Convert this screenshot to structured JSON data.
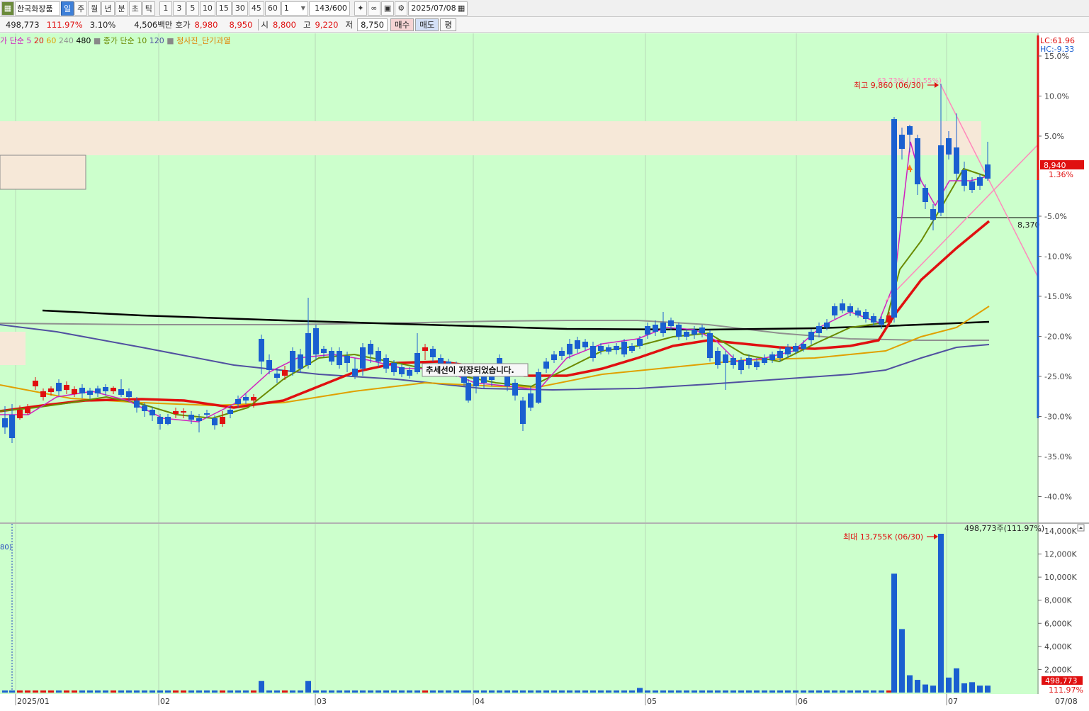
{
  "toolbar": {
    "stock_name": "한국화장품",
    "period_tabs": [
      {
        "label": "일",
        "active": true
      },
      {
        "label": "주",
        "active": false
      },
      {
        "label": "월",
        "active": false
      },
      {
        "label": "년",
        "active": false
      },
      {
        "label": "분",
        "active": false
      },
      {
        "label": "초",
        "active": false
      },
      {
        "label": "틱",
        "active": false
      }
    ],
    "interval_buttons": [
      "1",
      "3",
      "5",
      "10",
      "15",
      "30",
      "45",
      "60"
    ],
    "interval_select": "1",
    "count": "143",
    "count_total": "/600",
    "date": "2025/07/08"
  },
  "quote": {
    "volume": "498,773",
    "volume_ratio": "111.97%",
    "change_rate": "3.10%",
    "amount": "4,506백만",
    "bid_label": "호가",
    "bid1": "8,980",
    "bid2": "8,950",
    "open_label": "시",
    "open": "8,800",
    "high_label": "고",
    "high": "9,220",
    "low_label": "저",
    "low": "8,750",
    "buy_label": "매수",
    "sell_label": "매도",
    "flat_label": "평"
  },
  "legend": {
    "ma_prefix": "가 단순",
    "ma_values": [
      {
        "label": "5",
        "color": "#d020c0"
      },
      {
        "label": "20",
        "color": "#e01010"
      },
      {
        "label": "60",
        "color": "#e0a000"
      },
      {
        "label": "240",
        "color": "#909090"
      },
      {
        "label": "480",
        "color": "#000000"
      }
    ],
    "ma2_prefix": "종가 단순",
    "ma2_values": [
      {
        "label": "10",
        "color": "#6a8a00"
      },
      {
        "label": "120",
        "color": "#5050a0"
      }
    ],
    "indicator": "청사진_단기과열"
  },
  "right_axis": {
    "lc": "LC:61.96",
    "hc": "HC:-9.33",
    "ticks": [
      "15.0%",
      "10.0%",
      "5.0%",
      "-5.0%",
      "-10.0%",
      "-15.0%",
      "-20.0%",
      "-25.0%",
      "-30.0%",
      "-35.0%",
      "-40.0%"
    ],
    "current_price": "8,940",
    "current_pct": "1.36%",
    "level_price": "8,370"
  },
  "annotations": {
    "high_label": "최고 9,860 (06/30)",
    "high_pct": "63.73% (-10.55%)",
    "trendline_msg": "추세선이 저장되었습니다.",
    "vol_max_label": "최대 13,755K (06/30)",
    "vol_current": "498,773주(111.97%)",
    "vol_marker": "80)"
  },
  "volume_axis": {
    "ticks": [
      "14,000K",
      "12,000K",
      "10,000K",
      "8,000K",
      "6,000K",
      "4,000K",
      "2,000K"
    ],
    "current_value": "498,773",
    "current_pct": "111.97%"
  },
  "x_axis": {
    "labels": [
      "2025/01",
      "02",
      "03",
      "04",
      "05",
      "06",
      "07",
      "07/08"
    ]
  },
  "colors": {
    "bg": "#ccffcc",
    "up": "#e01010",
    "down": "#1a5fd0",
    "zone": "#f6e8d8"
  },
  "chart_data": {
    "type": "candlestick",
    "y_axis": "percent change from reference",
    "ylim": [
      -40,
      15
    ],
    "price_high": 9860,
    "price_high_date": "06/30",
    "current_price": 8940,
    "series": [
      {
        "name": "5",
        "color": "#d020c0"
      },
      {
        "name": "10",
        "color": "#6a8a00"
      },
      {
        "name": "20",
        "color": "#e01010"
      },
      {
        "name": "60",
        "color": "#e0a000"
      },
      {
        "name": "120",
        "color": "#5050a0"
      },
      {
        "name": "240",
        "color": "#909090"
      },
      {
        "name": "480",
        "color": "#000000"
      }
    ],
    "volume_max": 13755,
    "volume_unit": "K",
    "volume_max_date": "06/30"
  }
}
